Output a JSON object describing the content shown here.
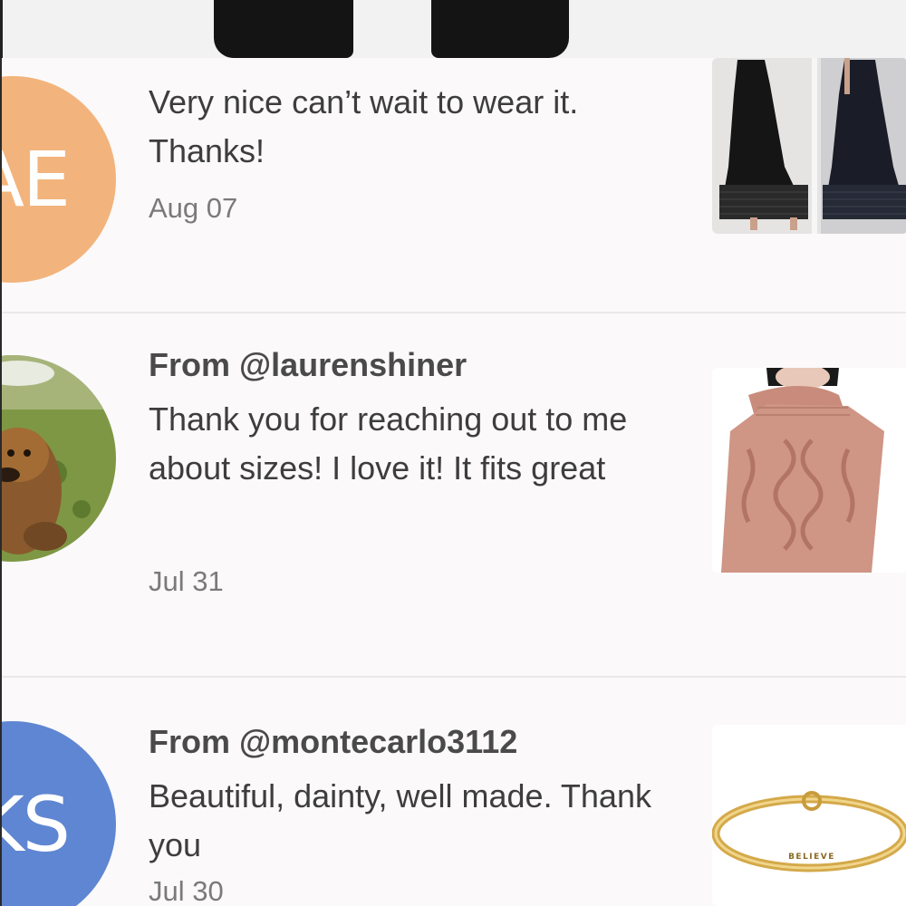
{
  "reviews": [
    {
      "from": "",
      "message": "Very nice can’t wait to wear it. Thanks!",
      "date": "Aug 07",
      "avatar_initials": "AE",
      "avatar_color": "#f2b47c",
      "product_icon": "black-maxi-dress-photo"
    },
    {
      "from": "From @laurenshiner",
      "message": "Thank you for reaching out to me about sizes! I love it! It fits great",
      "date": "Jul 31",
      "avatar_initials": "",
      "avatar_color": "#6f8a3a",
      "product_icon": "pink-cable-knit-sweater-photo"
    },
    {
      "from": "From @montecarlo3112",
      "message": "Beautiful, dainty, well made. Thank you",
      "date": "Jul 30",
      "avatar_initials": "KS",
      "avatar_color": "#5f86d2",
      "product_icon": "gold-bangle-bracelet-photo",
      "engraving": "BELIEVE"
    }
  ]
}
